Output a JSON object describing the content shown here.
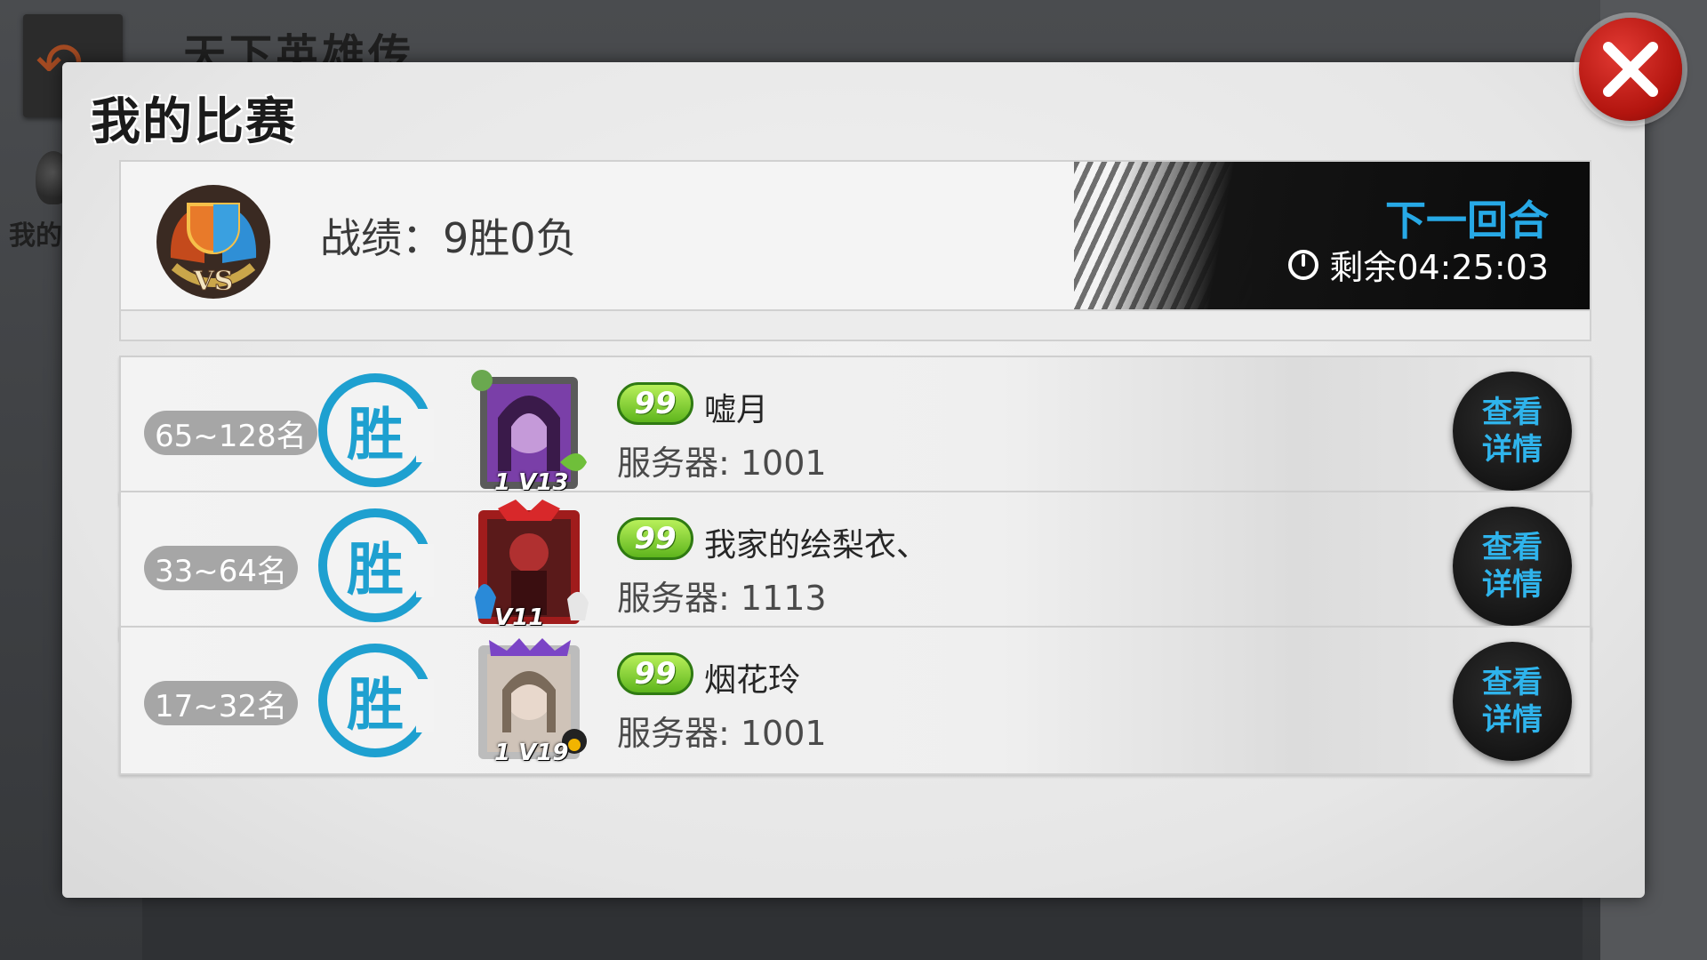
{
  "background": {
    "title": "天下英雄传",
    "side_label": "我的比"
  },
  "panel": {
    "title": "我的比赛"
  },
  "record": {
    "label": "战绩：9胜0负",
    "next_round_label": "下一回合",
    "countdown": "剩余04:25:03"
  },
  "matches": [
    {
      "rank": "65~128名",
      "result": "胜",
      "vip": "1 V13",
      "level": "99",
      "name": "嘘月",
      "server": "服务器: 1001",
      "detail_label": "查看\n详情",
      "avatar_colors": [
        "#7a3fa8",
        "#c59ad9"
      ]
    },
    {
      "rank": "33~64名",
      "result": "胜",
      "vip": "V11",
      "level": "99",
      "name": "我家的绘梨衣、",
      "server": "服务器: 1113",
      "detail_label": "查看\n详情",
      "avatar_colors": [
        "#5a1a1a",
        "#b03030"
      ]
    },
    {
      "rank": "17~32名",
      "result": "胜",
      "vip": "1 V19",
      "level": "99",
      "name": "烟花玲",
      "server": "服务器: 1001",
      "detail_label": "查看\n详情",
      "avatar_colors": [
        "#cfc3b8",
        "#7b45c6"
      ]
    }
  ],
  "colors": {
    "accent_blue": "#27a9e6",
    "win_blue": "#1ea0d0",
    "close_red": "#c01a12",
    "level_green": "#5eb51d"
  },
  "icons": {
    "close": "close-icon",
    "clock": "clock-icon",
    "vs": "vs-trophy-icon"
  }
}
